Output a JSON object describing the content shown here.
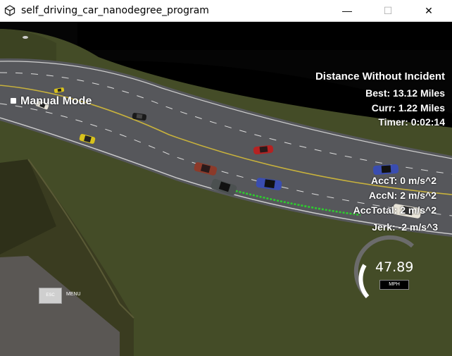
{
  "window": {
    "title": "self_driving_car_nanodegree_program",
    "minimize_glyph": "—",
    "maximize_glyph": "☐",
    "close_glyph": "✕"
  },
  "hud": {
    "mode_label": "Manual Mode",
    "distance_title": "Distance Without Incident",
    "best": "Best: 13.12 Miles",
    "curr": "Curr: 1.22 Miles",
    "timer": "Timer: 0:02:14",
    "acc_t": "AccT: 0 m/s^2",
    "acc_n": "AccN: 2 m/s^2",
    "acc_total": "AccTotal: 2 m/s^2",
    "jerk": "Jerk: -2 m/s^3",
    "speed": "47.89",
    "speed_unit": "MPH",
    "esc_label": "ESC",
    "menu_label": "MENU"
  },
  "scene": {
    "colors": {
      "sky": "#000000",
      "grass": "#4a5128",
      "road": "#55565a",
      "lane_yellow": "#c8b23c",
      "path_green": "#2ecc2e"
    },
    "cars": [
      {
        "name": "car-ego",
        "color": "#4b5050"
      },
      {
        "name": "car-blue-1",
        "color": "#3a4db0"
      },
      {
        "name": "car-blue-2",
        "color": "#3a4db0"
      },
      {
        "name": "car-red-1",
        "color": "#b52222"
      },
      {
        "name": "car-red-2",
        "color": "#8c3a2a"
      },
      {
        "name": "car-yellow-1",
        "color": "#d8c21c"
      },
      {
        "name": "car-yellow-2",
        "color": "#d8c21c"
      },
      {
        "name": "car-black",
        "color": "#1a1a1a"
      },
      {
        "name": "car-white-1",
        "color": "#e8e4d8"
      },
      {
        "name": "car-white-2",
        "color": "#e8e4d8"
      },
      {
        "name": "car-far",
        "color": "#cccccc"
      }
    ]
  }
}
